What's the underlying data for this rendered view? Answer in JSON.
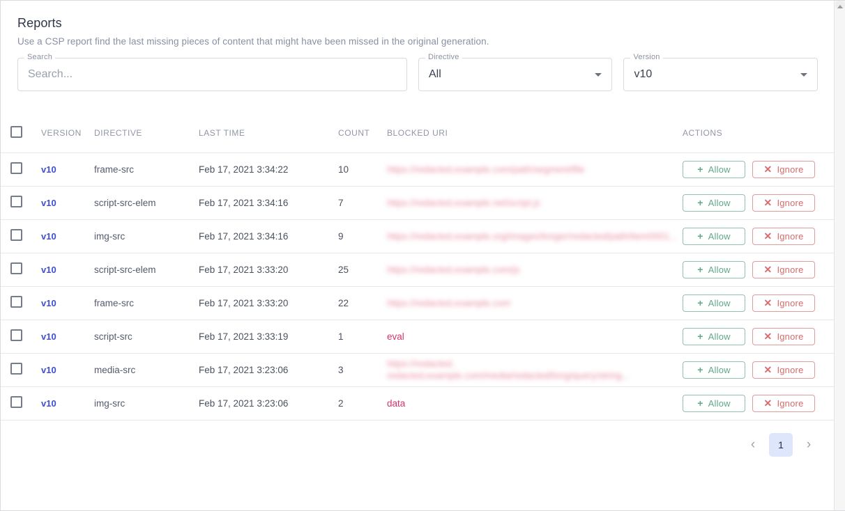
{
  "header": {
    "title": "Reports",
    "subtitle": "Use a CSP report find the last missing pieces of content that might have been missed in the original generation."
  },
  "filters": {
    "search": {
      "legend": "Search",
      "placeholder": "Search...",
      "value": ""
    },
    "directive": {
      "legend": "Directive",
      "value": "All"
    },
    "version": {
      "legend": "Version",
      "value": "v10"
    }
  },
  "table": {
    "columns": [
      "VERSION",
      "DIRECTIVE",
      "LAST TIME",
      "COUNT",
      "BLOCKED URI",
      "ACTIONS"
    ],
    "rows": [
      {
        "version": "v10",
        "directive": "frame-src",
        "last_time": "Feb 17, 2021 3:34:22",
        "count": "10",
        "blocked_uri": "https://redacted.example.com/path/segment/file",
        "redacted": true,
        "lines": 1
      },
      {
        "version": "v10",
        "directive": "script-src-elem",
        "last_time": "Feb 17, 2021 3:34:16",
        "count": "7",
        "blocked_uri": "https://redacted.example.net/script.js",
        "redacted": true,
        "lines": 1
      },
      {
        "version": "v10",
        "directive": "img-src",
        "last_time": "Feb 17, 2021 3:34:16",
        "count": "9",
        "blocked_uri": "https://redacted.example.org/images/longer/redacted/path/item0001...",
        "redacted": true,
        "lines": 1
      },
      {
        "version": "v10",
        "directive": "script-src-elem",
        "last_time": "Feb 17, 2021 3:33:20",
        "count": "25",
        "blocked_uri": "https://redacted.example.com/js",
        "redacted": true,
        "lines": 1
      },
      {
        "version": "v10",
        "directive": "frame-src",
        "last_time": "Feb 17, 2021 3:33:20",
        "count": "22",
        "blocked_uri": "https://redacted.example.com",
        "redacted": true,
        "lines": 1
      },
      {
        "version": "v10",
        "directive": "script-src",
        "last_time": "Feb 17, 2021 3:33:19",
        "count": "1",
        "blocked_uri": "eval",
        "redacted": false,
        "lines": 1
      },
      {
        "version": "v10",
        "directive": "media-src",
        "last_time": "Feb 17, 2021 3:23:06",
        "count": "3",
        "blocked_uri": "https://redacted.\nredacted.example.com/media/redacted/long/query/string...",
        "redacted": true,
        "lines": 2
      },
      {
        "version": "v10",
        "directive": "img-src",
        "last_time": "Feb 17, 2021 3:23:06",
        "count": "2",
        "blocked_uri": "data",
        "redacted": false,
        "lines": 1
      }
    ],
    "actions": {
      "allow_label": "Allow",
      "allow_icon": "+",
      "ignore_label": "Ignore",
      "ignore_icon": "✕"
    }
  },
  "pagination": {
    "prev_icon": "‹",
    "next_icon": "›",
    "pages": [
      "1"
    ],
    "current": "1"
  },
  "colors": {
    "link": "#3d4fd6",
    "allow": "#5fa886",
    "ignore": "#d96a6a",
    "uri": "#d6336c",
    "page_active_bg": "#dee6fb"
  }
}
